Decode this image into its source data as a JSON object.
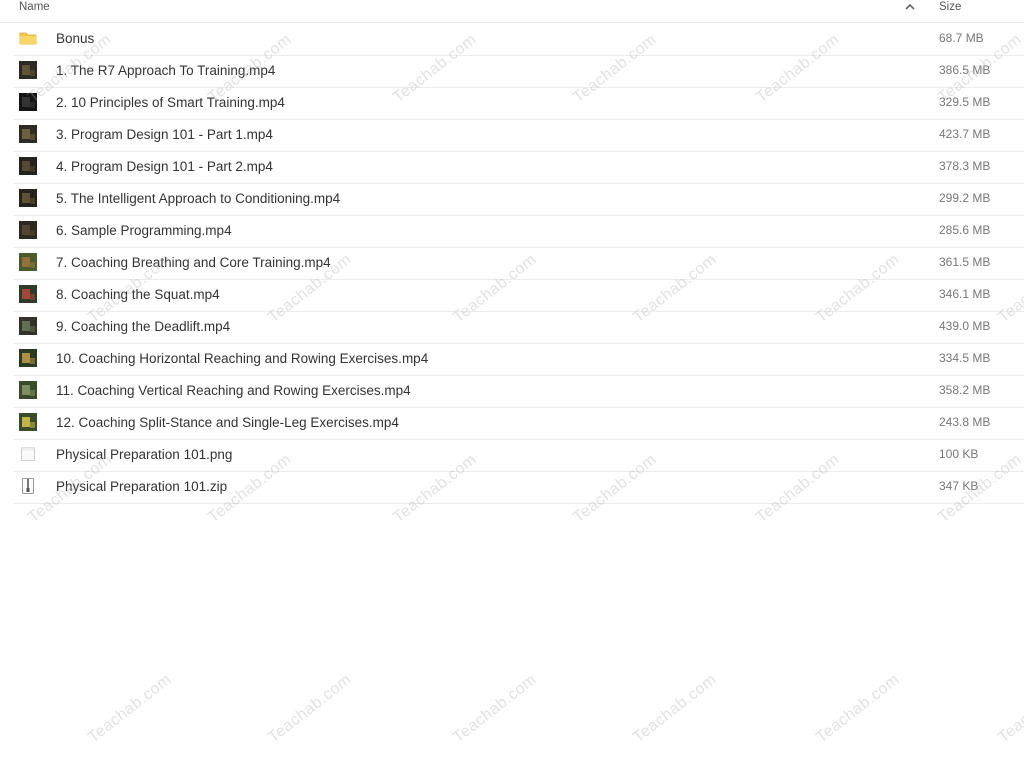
{
  "header": {
    "name_label": "Name",
    "size_label": "Size",
    "sort_icon": "chevron-up-icon"
  },
  "files": [
    {
      "name": "Bonus",
      "size": "68.7 MB",
      "type": "folder"
    },
    {
      "name": "1. The R7 Approach To Training.mp4",
      "size": "386.5 MB",
      "type": "video"
    },
    {
      "name": "2. 10 Principles of Smart Training.mp4",
      "size": "329.5 MB",
      "type": "video"
    },
    {
      "name": "3. Program Design 101 - Part 1.mp4",
      "size": "423.7 MB",
      "type": "video"
    },
    {
      "name": "4. Program Design 101 - Part 2.mp4",
      "size": "378.3 MB",
      "type": "video"
    },
    {
      "name": "5. The Intelligent Approach to Conditioning.mp4",
      "size": "299.2 MB",
      "type": "video"
    },
    {
      "name": "6. Sample Programming.mp4",
      "size": "285.6 MB",
      "type": "video"
    },
    {
      "name": "7. Coaching Breathing and Core Training.mp4",
      "size": "361.5 MB",
      "type": "video"
    },
    {
      "name": "8. Coaching the Squat.mp4",
      "size": "346.1 MB",
      "type": "video"
    },
    {
      "name": "9. Coaching the Deadlift.mp4",
      "size": "439.0 MB",
      "type": "video"
    },
    {
      "name": "10. Coaching Horizontal Reaching and Rowing Exercises.mp4",
      "size": "334.5 MB",
      "type": "video"
    },
    {
      "name": "11. Coaching Vertical Reaching and Rowing Exercises.mp4",
      "size": "358.2 MB",
      "type": "video"
    },
    {
      "name": "12. Coaching Split-Stance and Single-Leg Exercises.mp4",
      "size": "243.8 MB",
      "type": "video"
    },
    {
      "name": "Physical Preparation 101.png",
      "size": "100 KB",
      "type": "image"
    },
    {
      "name": "Physical Preparation 101.zip",
      "size": "347 KB",
      "type": "archive"
    }
  ],
  "watermark_text": "Teachab.com",
  "colors": {
    "folder": "#f5c84c",
    "row_border": "#ececec",
    "text": "#333333",
    "size_text": "#777777"
  }
}
